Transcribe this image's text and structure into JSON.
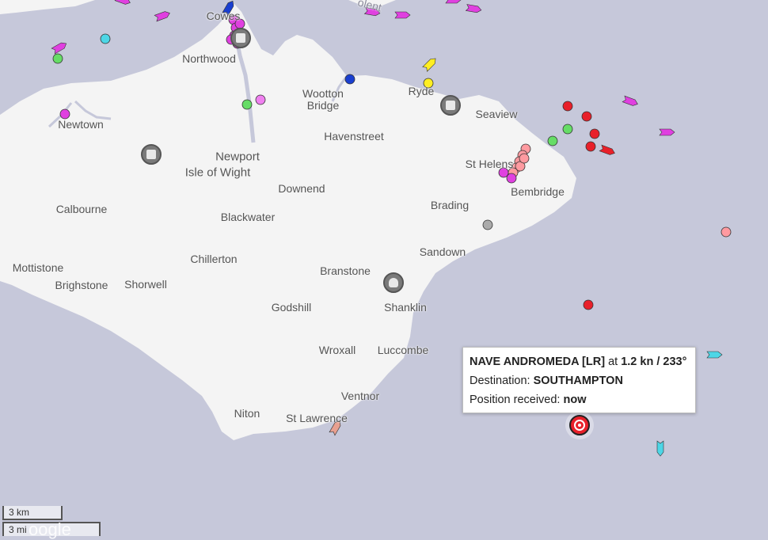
{
  "map": {
    "water_color": "#c6c8da",
    "land_color": "#f4f4f4",
    "places": [
      {
        "name": "Cowes"
      },
      {
        "name": "Northwood"
      },
      {
        "name": "Wootton"
      },
      {
        "name": "Bridge"
      },
      {
        "name": "Ryde"
      },
      {
        "name": "Seaview"
      },
      {
        "name": "Newtown"
      },
      {
        "name": "Havenstreet"
      },
      {
        "name": "Newport"
      },
      {
        "name": "Isle of Wight"
      },
      {
        "name": "St Helens"
      },
      {
        "name": "Downend"
      },
      {
        "name": "Bembridge"
      },
      {
        "name": "Brading"
      },
      {
        "name": "Calbourne"
      },
      {
        "name": "Blackwater"
      },
      {
        "name": "Sandown"
      },
      {
        "name": "Chillerton"
      },
      {
        "name": "Mottistone"
      },
      {
        "name": "Branstone"
      },
      {
        "name": "Brighstone"
      },
      {
        "name": "Shorwell"
      },
      {
        "name": "Godshill"
      },
      {
        "name": "Shanklin"
      },
      {
        "name": "Wroxall"
      },
      {
        "name": "Luccombe"
      },
      {
        "name": "Ventnor"
      },
      {
        "name": "Niton"
      },
      {
        "name": "St Lawrence"
      },
      {
        "name": "olent"
      }
    ],
    "pois": [
      {
        "icon": "harbour-icon"
      },
      {
        "icon": "harbour-icon"
      },
      {
        "icon": "building-icon"
      },
      {
        "icon": "person-icon"
      }
    ]
  },
  "vessels": [
    {
      "color": "#e040e0",
      "shape": "arrow"
    },
    {
      "color": "#e040e0",
      "shape": "arrow"
    },
    {
      "color": "#e040e0",
      "shape": "arrow"
    },
    {
      "color": "#e040e0",
      "shape": "arrow"
    },
    {
      "color": "#e040e0",
      "shape": "arrow"
    },
    {
      "color": "#4dd6e6",
      "shape": "dot"
    },
    {
      "color": "#66dd66",
      "shape": "dot"
    },
    {
      "color": "#e040e0",
      "shape": "arrow"
    },
    {
      "color": "#1a3fd0",
      "shape": "arrow"
    },
    {
      "color": "#e040e0",
      "shape": "dot"
    },
    {
      "color": "#e040e0",
      "shape": "dot"
    },
    {
      "color": "#e040e0",
      "shape": "dot"
    },
    {
      "color": "#e040e0",
      "shape": "dot"
    },
    {
      "color": "#e040e0",
      "shape": "dot"
    },
    {
      "color": "#e040e0",
      "shape": "dot"
    },
    {
      "color": "#66dd66",
      "shape": "dot"
    },
    {
      "color": "#f080f0",
      "shape": "dot"
    },
    {
      "color": "#1a3fd0",
      "shape": "dot"
    },
    {
      "color": "#ffee22",
      "shape": "arrow"
    },
    {
      "color": "#ffee22",
      "shape": "dot"
    },
    {
      "color": "#e040e0",
      "shape": "dot"
    },
    {
      "color": "#e8202a",
      "shape": "dot"
    },
    {
      "color": "#e8202a",
      "shape": "dot"
    },
    {
      "color": "#66dd66",
      "shape": "dot"
    },
    {
      "color": "#e8202a",
      "shape": "dot"
    },
    {
      "color": "#66dd66",
      "shape": "dot"
    },
    {
      "color": "#e8202a",
      "shape": "dot"
    },
    {
      "color": "#e8202a",
      "shape": "arrow"
    },
    {
      "color": "#e040e0",
      "shape": "arrow"
    },
    {
      "color": "#e040e0",
      "shape": "arrow"
    },
    {
      "color": "#ff9aa0",
      "shape": "dot"
    },
    {
      "color": "#ff9aa0",
      "shape": "dot"
    },
    {
      "color": "#ff9aa0",
      "shape": "dot"
    },
    {
      "color": "#ff9aa0",
      "shape": "dot"
    },
    {
      "color": "#ff9aa0",
      "shape": "dot"
    },
    {
      "color": "#ff9aa0",
      "shape": "dot"
    },
    {
      "color": "#ff9aa0",
      "shape": "dot"
    },
    {
      "color": "#e040e0",
      "shape": "dot"
    },
    {
      "color": "#e040e0",
      "shape": "dot"
    },
    {
      "color": "#aaaaaa",
      "shape": "dot"
    },
    {
      "color": "#ff9aa0",
      "shape": "dot"
    },
    {
      "color": "#e8202a",
      "shape": "dot"
    },
    {
      "color": "#4dd6e6",
      "shape": "arrow"
    },
    {
      "color": "#4dd6e6",
      "shape": "arrow"
    },
    {
      "color": "#e8a090",
      "shape": "arrow"
    },
    {
      "color": "#e040e0",
      "shape": "arrow"
    },
    {
      "color": "#e040e0",
      "shape": "arrow"
    },
    {
      "color": "#e040e0",
      "shape": "arrow"
    }
  ],
  "selected_vessel": {
    "color": "#e8202a",
    "icon": "target-icon"
  },
  "tooltip": {
    "vessel_name": "NAVE ANDROMEDA [LR]",
    "at_text": " at ",
    "speed_course": "1.2 kn / 233°",
    "destination_label": "Destination: ",
    "destination": "SOUTHAMPTON",
    "position_label": "Position received: ",
    "position_value": "now"
  },
  "scale": {
    "km": "3 km",
    "mi": "3 mi"
  },
  "logo": "oogle"
}
